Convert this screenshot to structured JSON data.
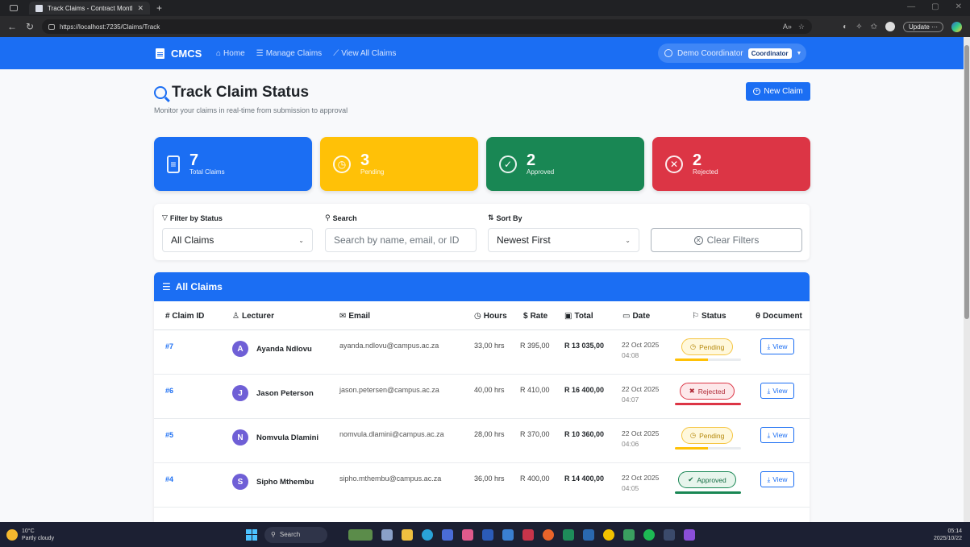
{
  "browser": {
    "tab_title": "Track Claims - Contract Monthly C",
    "url": "https://localhost:7235/Claims/Track",
    "update_label": "Update"
  },
  "nav": {
    "brand": "CMCS",
    "links": [
      {
        "label": "Home",
        "icon": "home-icon"
      },
      {
        "label": "Manage Claims",
        "icon": "list-icon"
      },
      {
        "label": "View All Claims",
        "icon": "chart-icon"
      }
    ],
    "user_name": "Demo Coordinator",
    "role": "Coordinator"
  },
  "header": {
    "title": "Track Claim Status",
    "subtitle": "Monitor your claims in real-time from submission to approval",
    "new_claim": "New Claim"
  },
  "stats": [
    {
      "value": "7",
      "label": "Total Claims",
      "color": "#1b6ef3",
      "icon": "document-icon"
    },
    {
      "value": "3",
      "label": "Pending",
      "color": "#ffc107",
      "icon": "clock-icon"
    },
    {
      "value": "2",
      "label": "Approved",
      "color": "#198754",
      "icon": "check-circle-icon"
    },
    {
      "value": "2",
      "label": "Rejected",
      "color": "#dc3545",
      "icon": "x-circle-icon"
    }
  ],
  "filters": {
    "status_label": "Filter by Status",
    "status_value": "All Claims",
    "search_label": "Search",
    "search_placeholder": "Search by name, email, or ID",
    "sort_label": "Sort By",
    "sort_value": "Newest First",
    "clear_label": "Clear Filters"
  },
  "table": {
    "title": "All Claims",
    "columns": {
      "id": "# Claim ID",
      "lecturer": "Lecturer",
      "email": "Email",
      "hours": "Hours",
      "rate": "Rate",
      "total": "Total",
      "date": "Date",
      "status": "Status",
      "document": "Document"
    },
    "view_label": "View",
    "rows": [
      {
        "id": "#7",
        "initial": "A",
        "name": "Ayanda Ndlovu",
        "email": "ayanda.ndlovu@campus.ac.za",
        "hours": "33,00 hrs",
        "rate": "R 395,00",
        "total": "R 13 035,00",
        "date": "22 Oct 2025",
        "time": "04:08",
        "status": "Pending",
        "progress": 0.5
      },
      {
        "id": "#6",
        "initial": "J",
        "name": "Jason Peterson",
        "email": "jason.petersen@campus.ac.za",
        "hours": "40,00 hrs",
        "rate": "R 410,00",
        "total": "R 16 400,00",
        "date": "22 Oct 2025",
        "time": "04:07",
        "status": "Rejected",
        "progress": 1.0
      },
      {
        "id": "#5",
        "initial": "N",
        "name": "Nomvula Dlamini",
        "email": "nomvula.dlamini@campus.ac.za",
        "hours": "28,00 hrs",
        "rate": "R 370,00",
        "total": "R 10 360,00",
        "date": "22 Oct 2025",
        "time": "04:06",
        "status": "Pending",
        "progress": 0.5
      },
      {
        "id": "#4",
        "initial": "S",
        "name": "Sipho Mthembu",
        "email": "sipho.mthembu@campus.ac.za",
        "hours": "36,00 hrs",
        "rate": "R 400,00",
        "total": "R 14 400,00",
        "date": "22 Oct 2025",
        "time": "04:05",
        "status": "Approved",
        "progress": 1.0
      }
    ]
  },
  "taskbar": {
    "temp": "10°C",
    "weather": "Partly cloudy",
    "search": "Search",
    "time": "05:14",
    "date": "2025/10/22"
  }
}
